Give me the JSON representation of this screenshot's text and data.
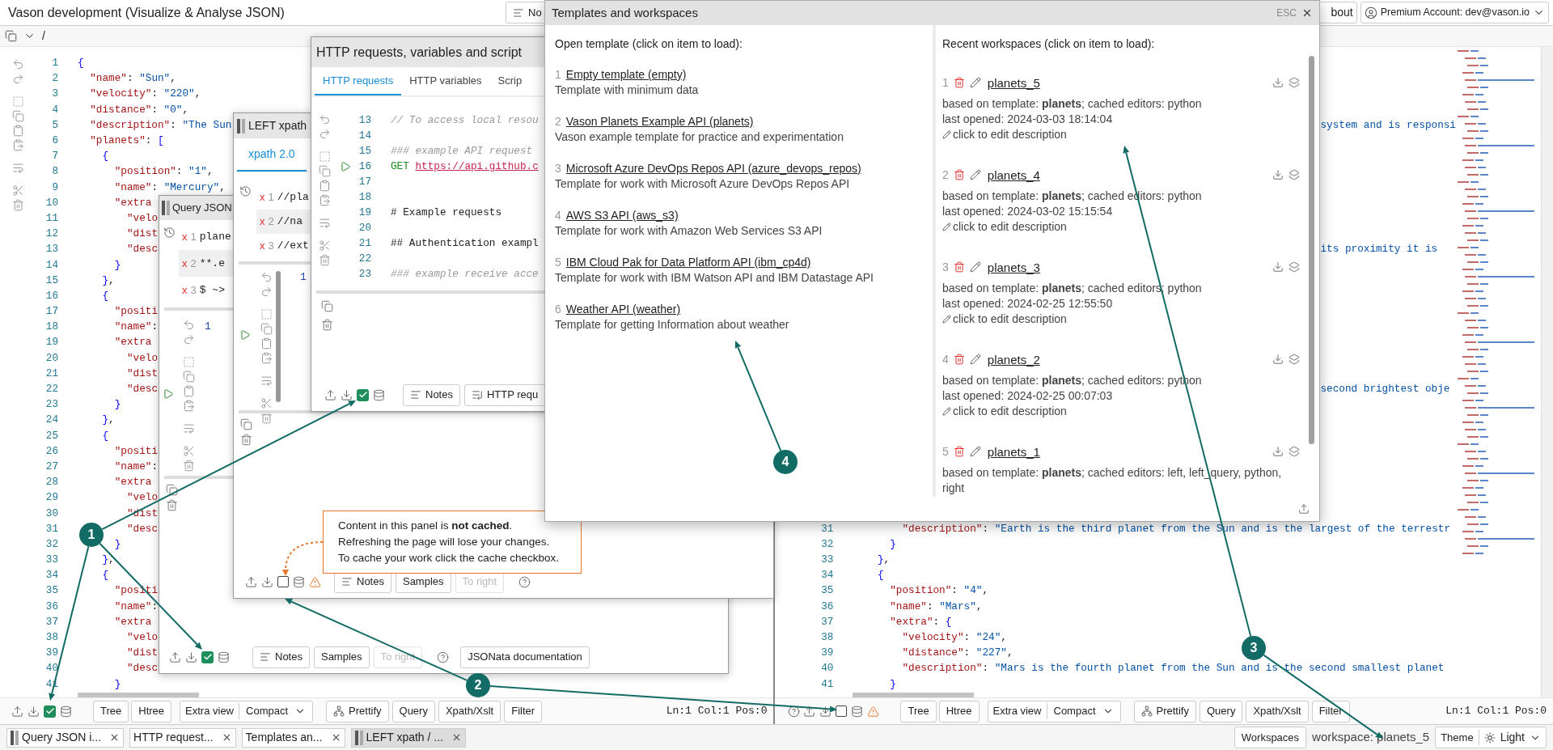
{
  "header": {
    "title": "Vason development (Visualize & Analyse JSON)",
    "notes_button": "No",
    "about_button": "bout",
    "account": "Premium Account: dev@vason.io"
  },
  "left_panel": {
    "path": "/",
    "lines": [
      {
        "number": "1",
        "code": "{"
      },
      {
        "number": "2",
        "code": "  \"name\": \"Sun\","
      },
      {
        "number": "3",
        "code": "  \"velocity\": \"220\","
      },
      {
        "number": "4",
        "code": "  \"distance\": \"0\","
      },
      {
        "number": "5",
        "code": "  \"description\": \"The Sun"
      },
      {
        "number": "6",
        "code": "  \"planets\": ["
      },
      {
        "number": "7",
        "code": "    {"
      },
      {
        "number": "8",
        "code": "      \"position\": \"1\","
      },
      {
        "number": "9",
        "code": "      \"name\": \"Mercury\","
      },
      {
        "number": "10",
        "code": "      \"extra"
      },
      {
        "number": "11",
        "code": "        \"velo"
      },
      {
        "number": "12",
        "code": "        \"dist"
      },
      {
        "number": "13",
        "code": "        \"desc"
      },
      {
        "number": "14",
        "code": "      }"
      },
      {
        "number": "15",
        "code": "    },"
      },
      {
        "number": "16",
        "code": "    {"
      },
      {
        "number": "17",
        "code": "      \"positi"
      },
      {
        "number": "18",
        "code": "      \"name\":"
      },
      {
        "number": "19",
        "code": "      \"extra"
      },
      {
        "number": "20",
        "code": "        \"velo"
      },
      {
        "number": "21",
        "code": "        \"dist"
      },
      {
        "number": "22",
        "code": "        \"desc"
      },
      {
        "number": "23",
        "code": "      }"
      },
      {
        "number": "24",
        "code": "    },"
      },
      {
        "number": "25",
        "code": "    {"
      },
      {
        "number": "26",
        "code": "      \"positi"
      },
      {
        "number": "27",
        "code": "      \"name\":"
      },
      {
        "number": "28",
        "code": "      \"extra"
      },
      {
        "number": "29",
        "code": "        \"velo"
      },
      {
        "number": "30",
        "code": "        \"dist"
      },
      {
        "number": "31",
        "code": "        \"desc"
      },
      {
        "number": "32",
        "code": "      }"
      },
      {
        "number": "33",
        "code": "    },"
      },
      {
        "number": "34",
        "code": "    {"
      },
      {
        "number": "35",
        "code": "      \"positi"
      },
      {
        "number": "36",
        "code": "      \"name\":"
      },
      {
        "number": "37",
        "code": "      \"extra"
      },
      {
        "number": "38",
        "code": "        \"velo"
      },
      {
        "number": "39",
        "code": "        \"dist"
      },
      {
        "number": "40",
        "code": "        \"desc"
      },
      {
        "number": "41",
        "code": "      }"
      }
    ],
    "cache_checked": true,
    "view_buttons": [
      "Tree",
      "Htree"
    ],
    "extra_view": "Extra view",
    "view_select": "Compact",
    "actions": [
      {
        "label": "Prettify",
        "kind": "prettify"
      },
      {
        "label": "Query",
        "kind": "plain"
      },
      {
        "label": "Xpath/Xslt",
        "kind": "plain"
      },
      {
        "label": "Filter",
        "kind": "plain"
      }
    ],
    "status": "Ln:1 Col:1 Pos:0"
  },
  "right_panel": {
    "fragments": [
      {
        "text": "system and is responsi"
      },
      {
        "text": "its proximity it is"
      },
      {
        "text": "second brightest obje"
      }
    ],
    "lines": [
      {
        "number": "31",
        "code": "        \"description\": \"Earth is the third planet from the Sun and is the largest of the terrestr"
      },
      {
        "number": "32",
        "code": "      }"
      },
      {
        "number": "33",
        "code": "    },"
      },
      {
        "number": "34",
        "code": "    {"
      },
      {
        "number": "35",
        "code": "      \"position\": \"4\","
      },
      {
        "number": "36",
        "code": "      \"name\": \"Mars\","
      },
      {
        "number": "37",
        "code": "      \"extra\": {"
      },
      {
        "number": "38",
        "code": "        \"velocity\": \"24\","
      },
      {
        "number": "39",
        "code": "        \"distance\": \"227\","
      },
      {
        "number": "40",
        "code": "        \"description\": \"Mars is the fourth planet from the Sun and is the second smallest planet"
      },
      {
        "number": "41",
        "code": "      }"
      }
    ],
    "cache_checked": false,
    "view_buttons": [
      "Tree",
      "Htree"
    ],
    "extra_view": "Extra view",
    "view_select": "Compact",
    "actions": [
      {
        "label": "Prettify",
        "kind": "prettify"
      },
      {
        "label": "Query",
        "kind": "plain"
      },
      {
        "label": "Xpath/Xslt",
        "kind": "plain"
      },
      {
        "label": "Filter",
        "kind": "plain"
      }
    ],
    "status": "Ln:1 Col:1 Pos:0"
  },
  "query_window": {
    "title": "Query JSON",
    "history": [
      {
        "mark": "x",
        "number": "1",
        "text": "plane",
        "selected": false
      },
      {
        "mark": "x",
        "number": "2",
        "text": "**.e",
        "selected": true
      },
      {
        "mark": "x",
        "number": "3",
        "text": "$ ~>",
        "selected": false
      }
    ],
    "editor_line": "1",
    "cache_checked": true,
    "buttons": [
      {
        "label": "Notes",
        "disabled": false
      },
      {
        "label": "Samples",
        "disabled": false
      },
      {
        "label": "To right",
        "disabled": true
      }
    ],
    "docs_button": "JSONata documentation"
  },
  "left_window": {
    "title": "LEFT xpath",
    "tab": {
      "label": "xpath 2.0",
      "selected": true
    },
    "history": [
      {
        "mark": "x",
        "number": "1",
        "text": "//pla",
        "selected": false
      },
      {
        "mark": "x",
        "number": "2",
        "text": "//na",
        "selected": true
      },
      {
        "mark": "x",
        "number": "3",
        "text": "//ext",
        "selected": false
      }
    ],
    "editor_line": "1",
    "cache_checked": false,
    "buttons": [
      {
        "label": "Notes",
        "disabled": false
      },
      {
        "label": "Samples",
        "disabled": false
      },
      {
        "label": "To right",
        "disabled": true
      }
    ]
  },
  "http_window": {
    "title": "HTTP requests, variables and script",
    "tabs": [
      {
        "label": "HTTP requests",
        "selected": true
      },
      {
        "label": "HTTP variables",
        "selected": false
      },
      {
        "label": "Scrip",
        "selected": false
      }
    ],
    "lines": [
      {
        "number": "13",
        "kind": "comment",
        "text": "// To access local resou"
      },
      {
        "number": "14",
        "kind": "blank"
      },
      {
        "number": "15",
        "kind": "comment",
        "text": "### example API request"
      },
      {
        "number": "16",
        "kind": "request",
        "method": "GET",
        "url": "https://api.github.c",
        "run": true
      },
      {
        "number": "17",
        "kind": "blank"
      },
      {
        "number": "18",
        "kind": "blank"
      },
      {
        "number": "19",
        "kind": "heading",
        "text": "# Example requests"
      },
      {
        "number": "20",
        "kind": "blank"
      },
      {
        "number": "21",
        "kind": "heading",
        "text": "## Authentication exampl"
      },
      {
        "number": "22",
        "kind": "blank"
      },
      {
        "number": "23",
        "kind": "comment",
        "text": "### example receive acce"
      }
    ],
    "cache_checked": true,
    "buttons": [
      {
        "label": "Notes",
        "kind": "notes"
      },
      {
        "label": "HTTP requ",
        "kind": "requests"
      }
    ]
  },
  "tooltip": {
    "lines": [
      "Content in this panel is **not cached**.",
      "Refreshing the page will lose your changes.",
      "To cache your work click the cache checkbox."
    ]
  },
  "templates_dialog": {
    "title": "Templates and workspaces",
    "esc": "ESC",
    "templates_heading": "Open template (click on item to load):",
    "templates": [
      {
        "number": "1",
        "name": "Empty template (empty)",
        "description": "Template with minimum data"
      },
      {
        "number": "2",
        "name": "Vason Planets Example API (planets)",
        "description": "Vason example template for practice and experimentation"
      },
      {
        "number": "3",
        "name": "Microsoft Azure DevOps Repos API (azure_devops_repos)",
        "description": "Template for work with Microsoft Azure DevOps Repos API"
      },
      {
        "number": "4",
        "name": "AWS S3 API (aws_s3)",
        "description": "Template for work with Amazon Web Services S3 API"
      },
      {
        "number": "5",
        "name": "IBM Cloud Pak for Data Platform API (ibm_cp4d)",
        "description": "Template for work with IBM Watson API and IBM Datastage API"
      },
      {
        "number": "6",
        "name": "Weather API (weather)",
        "description": "Template for getting Information about weather"
      }
    ],
    "workspaces_heading": "Recent workspaces (click on item to load):",
    "workspaces": [
      {
        "number": "1",
        "name": "planets_5",
        "info": "based on template: **planets**; cached editors: python",
        "opened": "last opened: 2024-03-03 18:14:04",
        "edit": "click to edit description"
      },
      {
        "number": "2",
        "name": "planets_4",
        "info": "based on template: **planets**; cached editors: python",
        "opened": "last opened: 2024-03-02 15:15:54",
        "edit": "click to edit description"
      },
      {
        "number": "3",
        "name": "planets_3",
        "info": "based on template: **planets**; cached editors: python",
        "opened": "last opened: 2024-02-25 12:55:50",
        "edit": "click to edit description"
      },
      {
        "number": "4",
        "name": "planets_2",
        "info": "based on template: **planets**; cached editors: python",
        "opened": "last opened: 2024-02-25 00:07:03",
        "edit": "click to edit description"
      },
      {
        "number": "5",
        "name": "planets_1",
        "info": "based on template: **planets**; cached editors: left, left_query, python, right"
      }
    ]
  },
  "taskbar": {
    "tabs": [
      {
        "label": "Query JSON i...",
        "kind": "panel",
        "selected": false
      },
      {
        "label": "HTTP request...",
        "kind": "plain",
        "selected": false
      },
      {
        "label": "Templates an...",
        "kind": "plain",
        "selected": false
      },
      {
        "label": "LEFT xpath / ...",
        "kind": "panel",
        "selected": true
      }
    ],
    "workspaces_button": "Workspaces",
    "workspace": "workspace: planets_5",
    "theme_label": "Theme",
    "theme": "Light"
  },
  "callouts": [
    {
      "label": "1"
    },
    {
      "label": "2"
    },
    {
      "label": "3"
    },
    {
      "label": "4"
    }
  ]
}
